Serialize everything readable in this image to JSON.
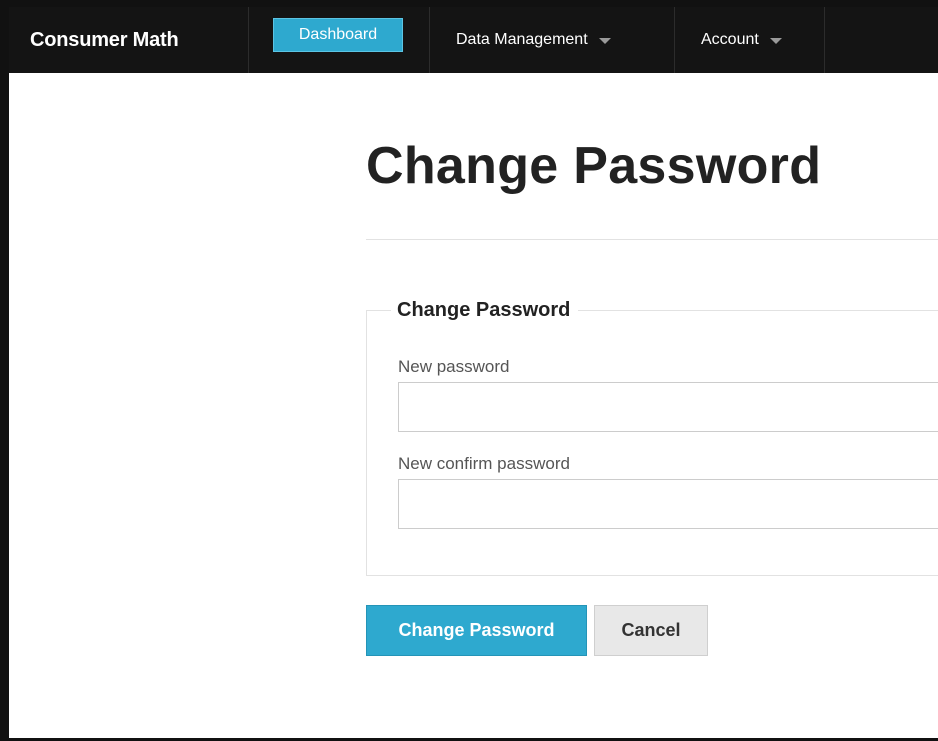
{
  "navbar": {
    "brand": "Consumer Math",
    "dashboard_label": "Dashboard",
    "data_management_label": "Data Management",
    "account_label": "Account"
  },
  "page": {
    "title": "Change Password"
  },
  "form": {
    "legend": "Change Password",
    "new_password_label": "New password",
    "new_password_value": "",
    "confirm_password_label": "New confirm password",
    "confirm_password_value": "",
    "submit_label": "Change Password",
    "cancel_label": "Cancel"
  },
  "colors": {
    "navbar_bg": "#141414",
    "accent": "#2ea9cf",
    "cancel_bg": "#e8e8e8"
  },
  "icons": {
    "dropdown": "caret-down-icon"
  }
}
